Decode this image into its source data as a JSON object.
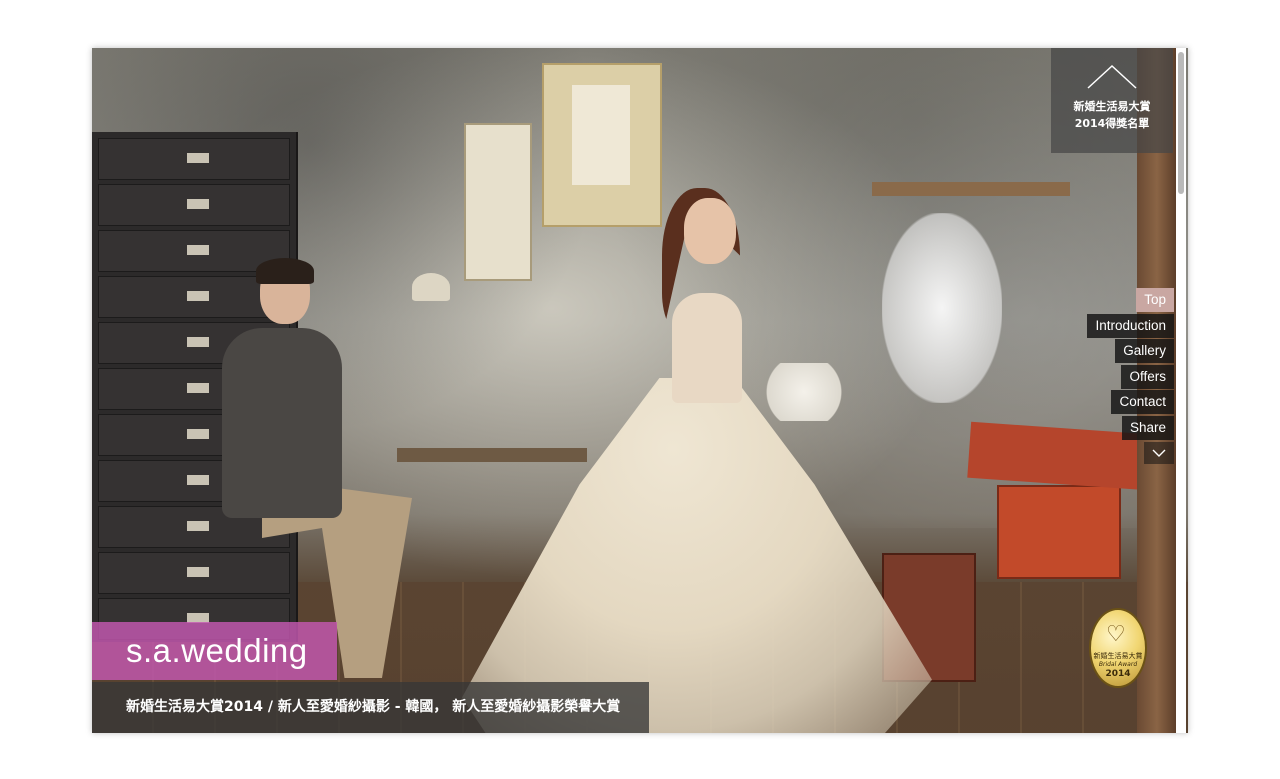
{
  "award_box": {
    "line1": "新婚生活易大賞",
    "line2": "2014得獎名單"
  },
  "nav": {
    "items": [
      {
        "label": "Top",
        "active": true
      },
      {
        "label": "Introduction",
        "active": false
      },
      {
        "label": "Gallery",
        "active": false
      },
      {
        "label": "Offers",
        "active": false
      },
      {
        "label": "Contact",
        "active": false
      },
      {
        "label": "Share",
        "active": false
      }
    ],
    "more_icon": "chevron-down-icon"
  },
  "brand": {
    "name": "s.a.wedding"
  },
  "caption": {
    "text": "新婚生活易大賞2014 / 新人至愛婚紗攝影 - 韓國， 新人至愛婚紗攝影榮譽大賞"
  },
  "badge": {
    "line1": "新婚生活易大賞",
    "line2": "Bridal Award",
    "line3": "2014"
  },
  "colors": {
    "brand_bg": "#c458b1",
    "nav_active": "#c9a7a2",
    "nav_bg": "#141414"
  }
}
